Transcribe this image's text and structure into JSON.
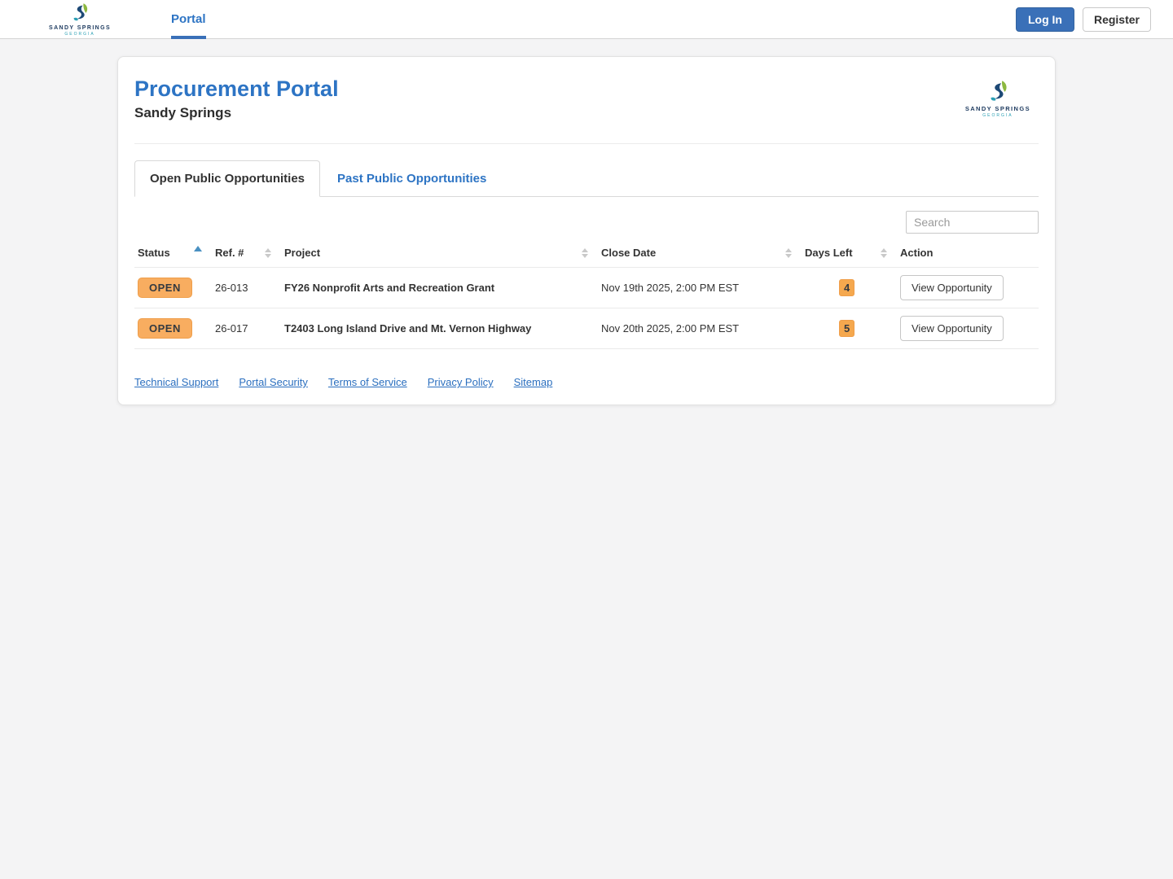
{
  "navbar": {
    "brand": {
      "name": "SANDY SPRINGS",
      "tagline": "GEORGIA"
    },
    "nav_items": [
      {
        "label": "Portal",
        "active": true
      }
    ],
    "login_label": "Log In",
    "register_label": "Register"
  },
  "page": {
    "title": "Procurement Portal",
    "subtitle": "Sandy Springs"
  },
  "tabs": [
    {
      "label": "Open Public Opportunities",
      "active": true
    },
    {
      "label": "Past Public Opportunities",
      "active": false
    }
  ],
  "search": {
    "placeholder": "Search"
  },
  "table": {
    "columns": [
      {
        "label": "Status",
        "sortable": true,
        "sort": "asc"
      },
      {
        "label": "Ref. #",
        "sortable": true,
        "sort": "none"
      },
      {
        "label": "Project",
        "sortable": true,
        "sort": "none"
      },
      {
        "label": "Close Date",
        "sortable": true,
        "sort": "none"
      },
      {
        "label": "Days Left",
        "sortable": true,
        "sort": "none"
      },
      {
        "label": "Action",
        "sortable": false,
        "sort": "none"
      }
    ],
    "rows": [
      {
        "status": "OPEN",
        "ref": "26-013",
        "project": "FY26 Nonprofit Arts and Recreation Grant",
        "close_date": "Nov 19th 2025, 2:00 PM EST",
        "days_left": "4",
        "action": "View Opportunity"
      },
      {
        "status": "OPEN",
        "ref": "26-017",
        "project": "T2403 Long Island Drive and Mt. Vernon Highway",
        "close_date": "Nov 20th 2025, 2:00 PM EST",
        "days_left": "5",
        "action": "View Opportunity"
      }
    ]
  },
  "footer": {
    "links": [
      "Technical Support",
      "Portal Security",
      "Terms of Service",
      "Privacy Policy",
      "Sitemap"
    ]
  },
  "colors": {
    "accent_blue": "#2d74c4",
    "login_button_blue": "#3a70b8",
    "status_badge_orange": "#f8ad60",
    "days_badge_orange": "#f5a84e",
    "link_blue": "#2b6fbf"
  }
}
